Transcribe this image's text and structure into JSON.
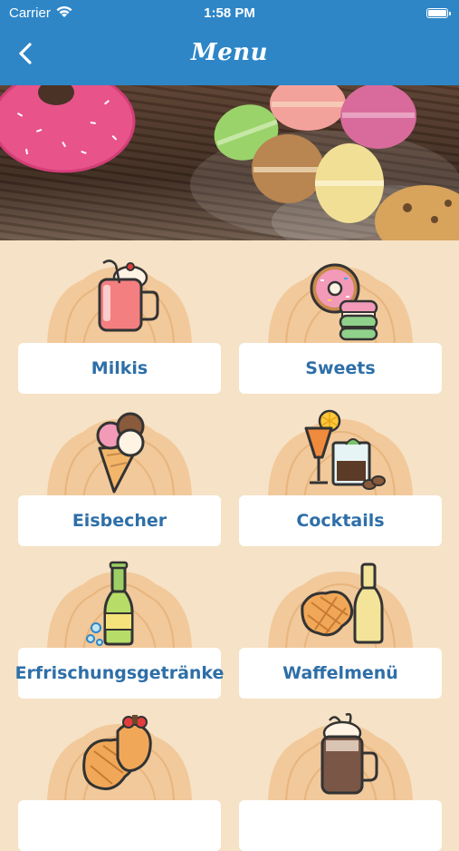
{
  "status_bar": {
    "carrier": "Carrier",
    "time": "1:58 PM"
  },
  "nav": {
    "title": "Menu",
    "back_icon": "chevron-left-icon"
  },
  "colors": {
    "nav_blue": "#2e86c7",
    "background": "#f6e2c6",
    "label_blue": "#2e6fa8",
    "fan": "#f1c99b"
  },
  "menu_items": [
    {
      "label": "Milkis",
      "icon": "milkshake-icon"
    },
    {
      "label": "Sweets",
      "icon": "donut-macaron-icon"
    },
    {
      "label": "Eisbecher",
      "icon": "ice-cream-cone-icon"
    },
    {
      "label": "Cocktails",
      "icon": "cocktail-icon"
    },
    {
      "label": "Erfrischungsgetränke",
      "icon": "soda-bottle-icon"
    },
    {
      "label": "Waffelmenü",
      "icon": "waffle-drink-icon"
    },
    {
      "label": "",
      "icon": "waffle-fruit-icon"
    },
    {
      "label": "",
      "icon": "hot-chocolate-icon"
    }
  ]
}
